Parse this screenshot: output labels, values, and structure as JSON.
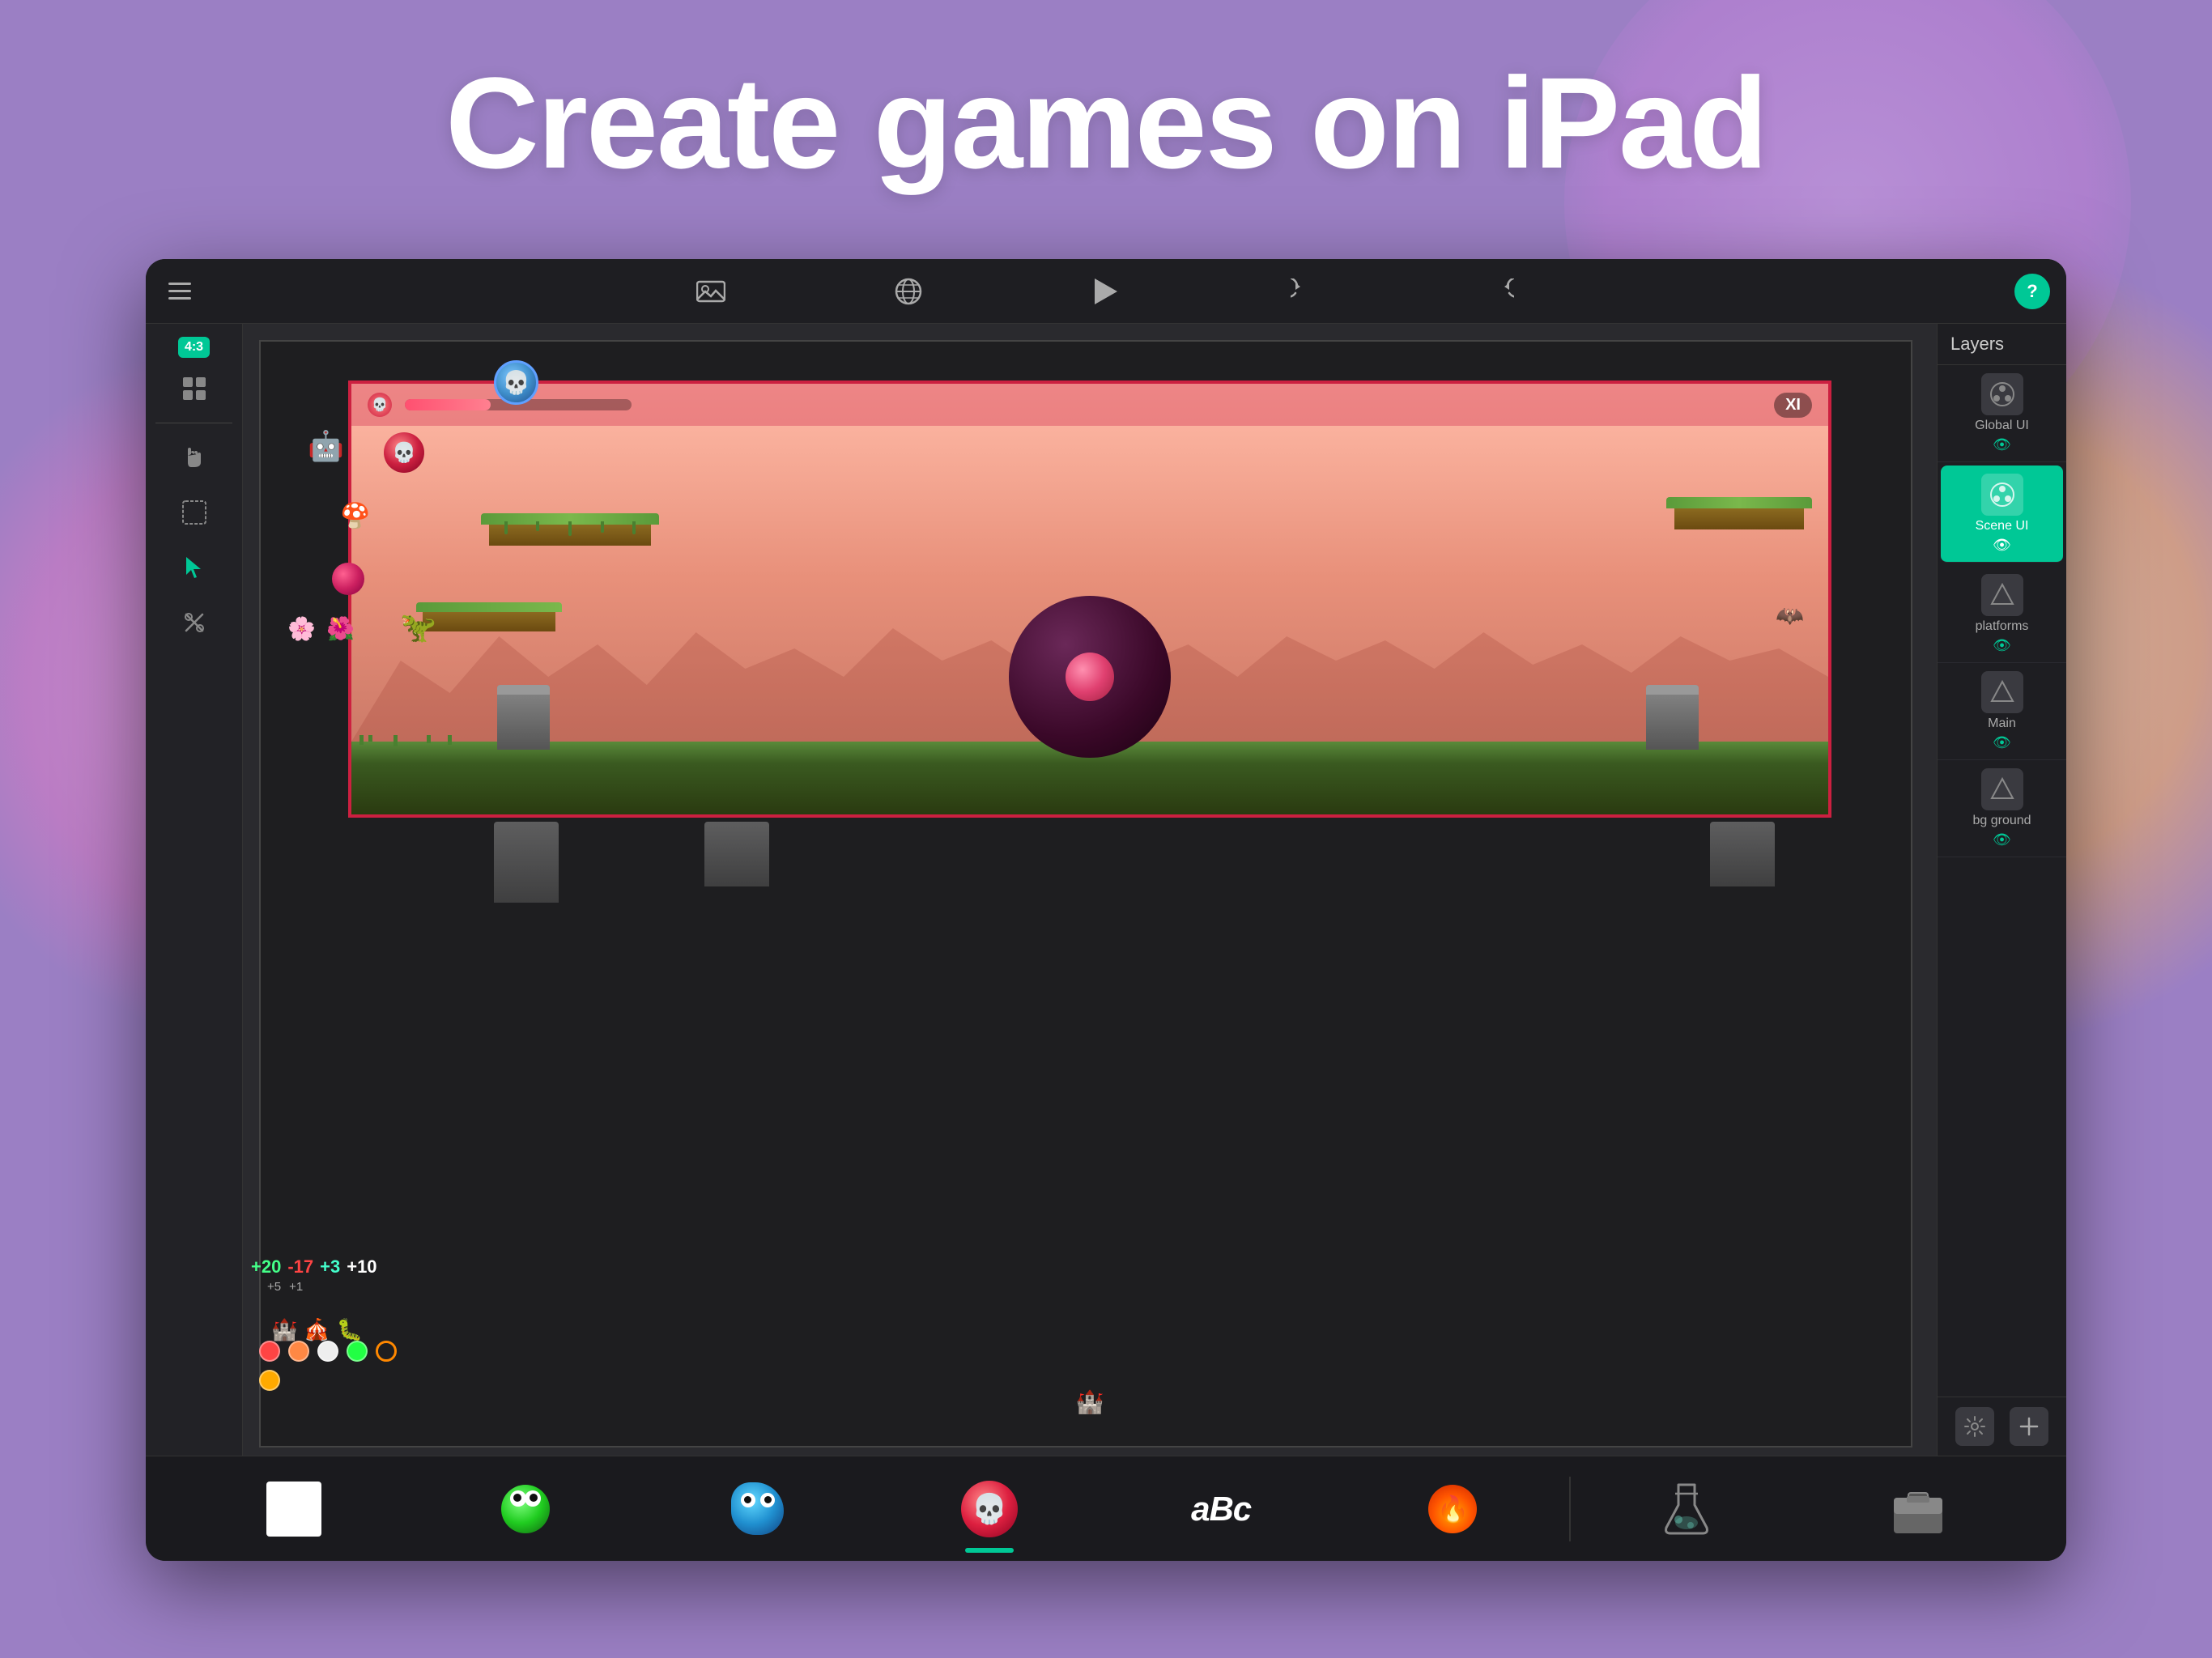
{
  "page": {
    "title": "Create games on iPad",
    "background_color": "#9b7fc4"
  },
  "toolbar": {
    "menu_icon": "☰",
    "image_icon": "🖼",
    "globe_icon": "🌐",
    "play_icon": "▶",
    "undo_icon": "↺",
    "redo_icon": "↻",
    "help_label": "?"
  },
  "left_tools": {
    "aspect_ratio": "4:3",
    "tools": [
      "grid",
      "hand",
      "select",
      "cursor",
      "scissors"
    ]
  },
  "layers": {
    "header": "Layers",
    "items": [
      {
        "name": "Global UI",
        "active": false
      },
      {
        "name": "Scene UI",
        "active": true
      },
      {
        "name": "platforms",
        "active": false
      },
      {
        "name": "Main",
        "active": false
      },
      {
        "name": "bg ground",
        "active": false
      }
    ],
    "add_button": "+",
    "settings_button": "⚙"
  },
  "game": {
    "health_label": "XI",
    "score_values": [
      "+20",
      "-17",
      "+3",
      "+10"
    ]
  },
  "bottom_dock": {
    "items": [
      {
        "type": "sprite",
        "label": "white-square"
      },
      {
        "type": "sprite",
        "label": "green-creature"
      },
      {
        "type": "sprite",
        "label": "blue-creature"
      },
      {
        "type": "sprite",
        "label": "red-skull",
        "active": true
      },
      {
        "type": "text",
        "label": "aBc"
      },
      {
        "type": "sprite",
        "label": "fire-creature"
      },
      {
        "type": "separator"
      },
      {
        "type": "flask",
        "label": "flask"
      },
      {
        "type": "box",
        "label": "asset-box"
      }
    ]
  },
  "colors": {
    "accent": "#00c896",
    "danger": "#ff4060",
    "toolbar_bg": "#1e1e22",
    "sidebar_bg": "#222226",
    "canvas_bg": "#2a2a2e",
    "layers_bg": "#1e1e22"
  }
}
